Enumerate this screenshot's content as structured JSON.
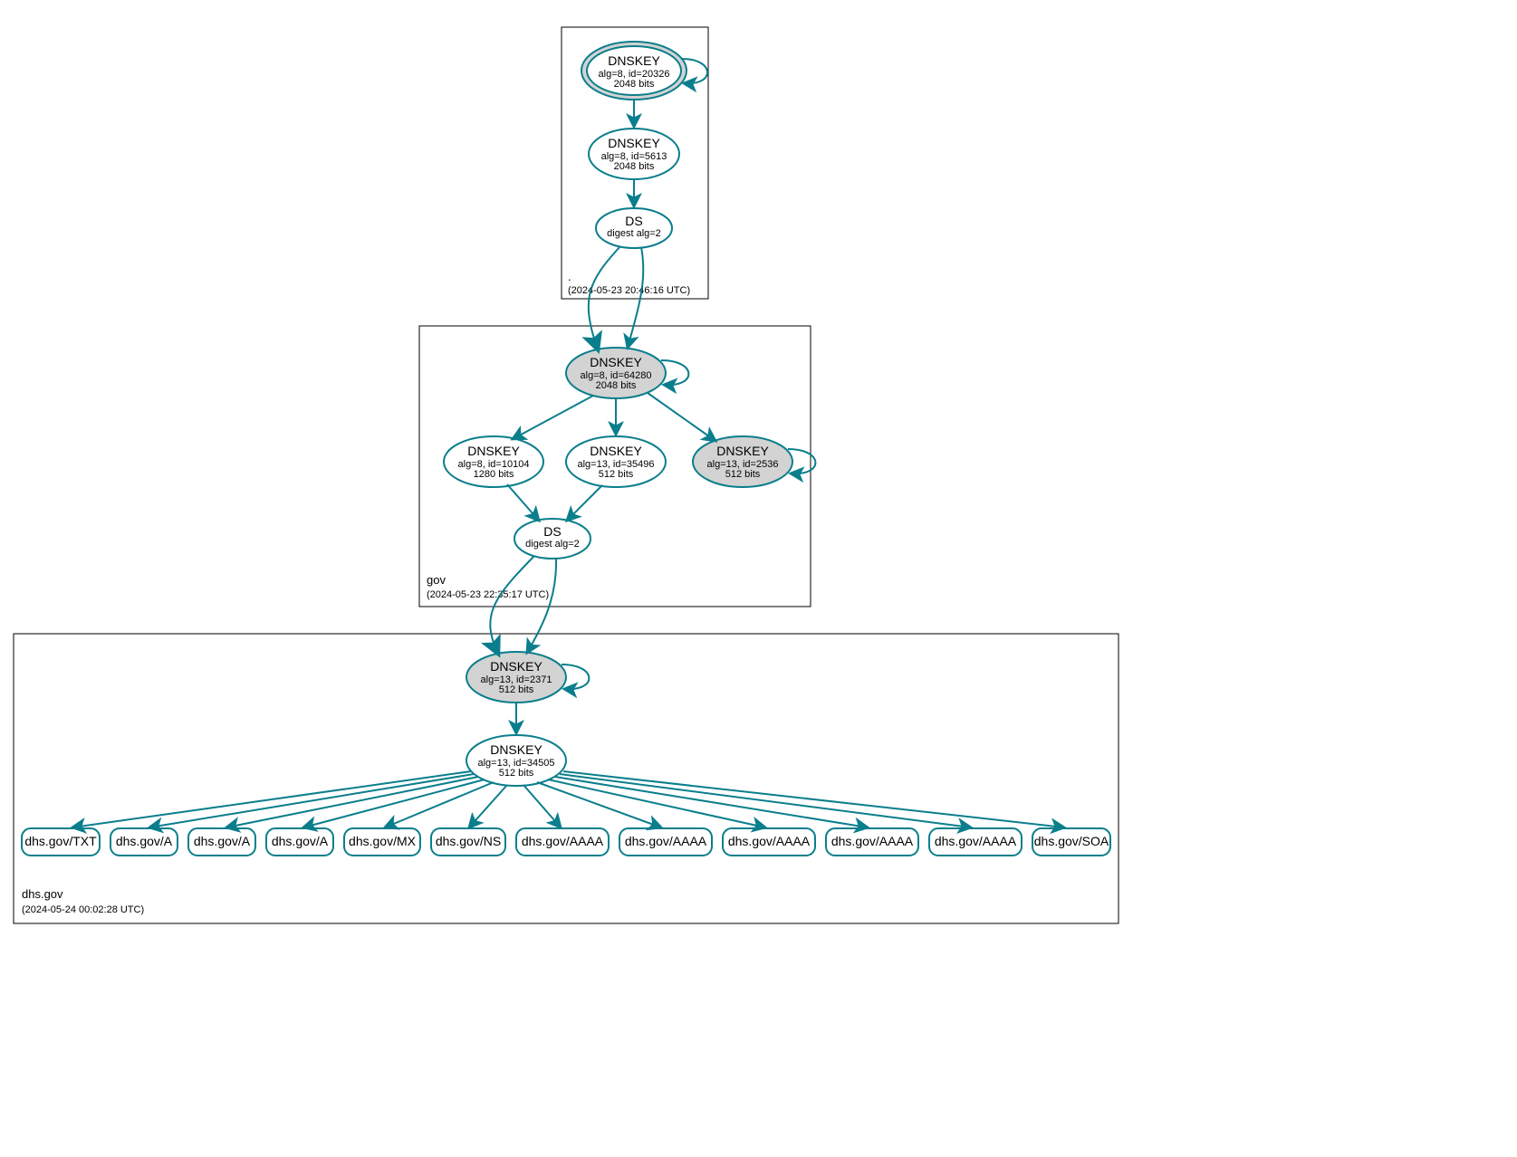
{
  "colors": {
    "line": "#0a7e8c",
    "sep": "#d3d3d3"
  },
  "zones": {
    "root": {
      "name": ".",
      "ts": "(2024-05-23 20:46:16 UTC)"
    },
    "gov": {
      "name": "gov",
      "ts": "(2024-05-23 22:35:17 UTC)"
    },
    "dhs": {
      "name": "dhs.gov",
      "ts": "(2024-05-24 00:02:28 UTC)"
    }
  },
  "nodes": {
    "root_ksk": {
      "title": "DNSKEY",
      "sub1": "alg=8, id=20326",
      "sub2": "2048 bits"
    },
    "root_zsk": {
      "title": "DNSKEY",
      "sub1": "alg=8, id=5613",
      "sub2": "2048 bits"
    },
    "root_ds": {
      "title": "DS",
      "sub1": "digest alg=2",
      "sub2": ""
    },
    "gov_ksk": {
      "title": "DNSKEY",
      "sub1": "alg=8, id=64280",
      "sub2": "2048 bits"
    },
    "gov_zsk1": {
      "title": "DNSKEY",
      "sub1": "alg=8, id=10104",
      "sub2": "1280 bits"
    },
    "gov_zsk2": {
      "title": "DNSKEY",
      "sub1": "alg=13, id=35496",
      "sub2": "512 bits"
    },
    "gov_ksk2": {
      "title": "DNSKEY",
      "sub1": "alg=13, id=2536",
      "sub2": "512 bits"
    },
    "gov_ds": {
      "title": "DS",
      "sub1": "digest alg=2",
      "sub2": ""
    },
    "dhs_ksk": {
      "title": "DNSKEY",
      "sub1": "alg=13, id=2371",
      "sub2": "512 bits"
    },
    "dhs_zsk": {
      "title": "DNSKEY",
      "sub1": "alg=13, id=34505",
      "sub2": "512 bits"
    }
  },
  "records": {
    "r0": "dhs.gov/TXT",
    "r1": "dhs.gov/A",
    "r2": "dhs.gov/A",
    "r3": "dhs.gov/A",
    "r4": "dhs.gov/MX",
    "r5": "dhs.gov/NS",
    "r6": "dhs.gov/AAAA",
    "r7": "dhs.gov/AAAA",
    "r8": "dhs.gov/AAAA",
    "r9": "dhs.gov/AAAA",
    "r10": "dhs.gov/AAAA",
    "r11": "dhs.gov/SOA"
  }
}
